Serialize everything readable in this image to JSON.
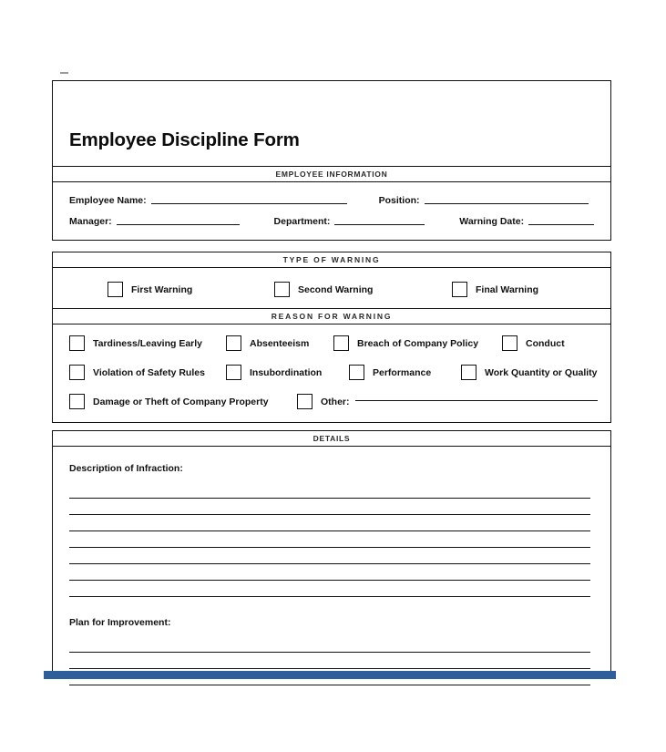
{
  "document": {
    "title": "Employee Discipline Form",
    "accent_color": "#2e5f9a",
    "border_color": "#111111",
    "background_color": "#ffffff"
  },
  "sections": {
    "employee_information": {
      "header": "EMPLOYEE INFORMATION",
      "fields": [
        {
          "label": "Employee Name:",
          "value": "",
          "rule_width": 215
        },
        {
          "label": "Position:",
          "value": "",
          "rule_width": 180
        },
        {
          "label": "Manager:",
          "value": "",
          "rule_width": 150
        },
        {
          "label": "Department:",
          "value": "",
          "rule_width": 110
        },
        {
          "label": "Warning Date:",
          "value": "",
          "rule_width": 80
        }
      ]
    },
    "type_of_warning": {
      "header": "TYPE OF WARNING",
      "options": [
        {
          "label": "First Warning",
          "checked": false
        },
        {
          "label": "Second Warning",
          "checked": false
        },
        {
          "label": "Final Warning",
          "checked": false
        }
      ]
    },
    "reason_for_warning": {
      "header": "REASON FOR WARNING",
      "rows": [
        [
          {
            "label": "Tardiness/Leaving Early",
            "checked": false
          },
          {
            "label": "Absenteeism",
            "checked": false
          },
          {
            "label": "Breach of Company Policy",
            "checked": false
          },
          {
            "label": "Conduct",
            "checked": false
          }
        ],
        [
          {
            "label": "Violation of Safety Rules",
            "checked": false
          },
          {
            "label": "Insubordination",
            "checked": false
          },
          {
            "label": "Performance",
            "checked": false
          },
          {
            "label": "Work Quantity or Quality",
            "checked": false
          }
        ],
        [
          {
            "label": "Damage or Theft of Company Property",
            "checked": false
          },
          {
            "label": "Other:",
            "checked": false,
            "has_rule": true,
            "value": ""
          }
        ]
      ]
    },
    "details": {
      "header": "DETAILS",
      "groups": [
        {
          "label": "Description of Infraction:",
          "line_count": 7,
          "value": ""
        },
        {
          "label": "Plan for Improvement:",
          "line_count": 3,
          "value": ""
        }
      ]
    }
  }
}
